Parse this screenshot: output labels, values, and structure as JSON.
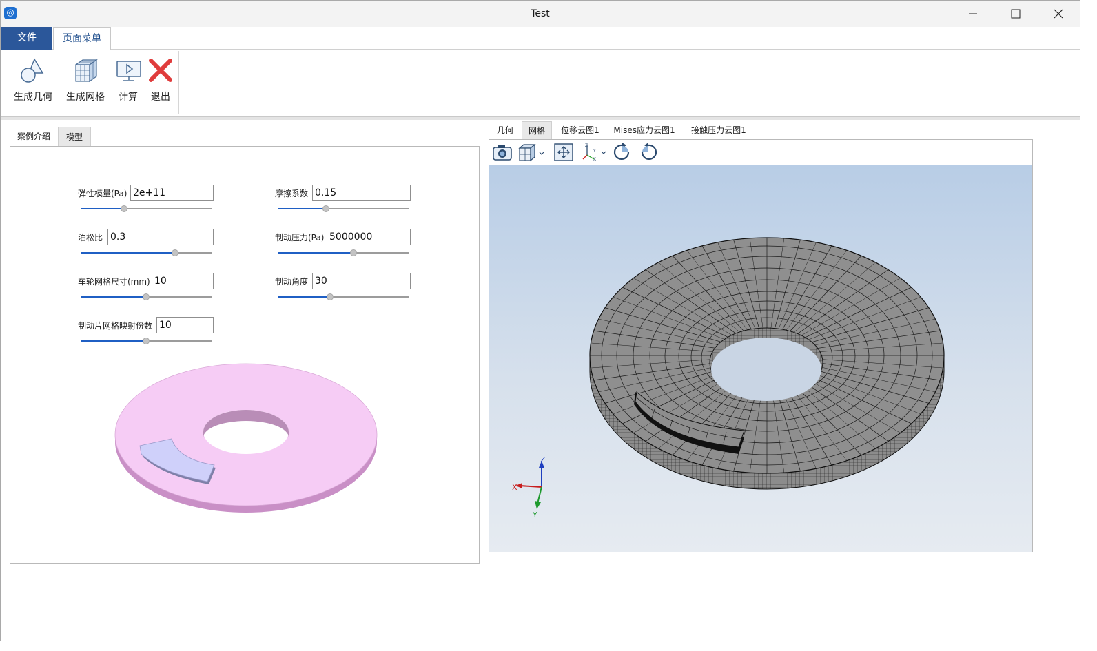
{
  "window": {
    "title": "Test"
  },
  "ribbon": {
    "tabs": [
      {
        "label": "文件"
      },
      {
        "label": "页面菜单"
      }
    ],
    "buttons": [
      {
        "label": "生成几何",
        "icon": "geometry-icon"
      },
      {
        "label": "生成网格",
        "icon": "mesh-cube-icon"
      },
      {
        "label": "计算",
        "icon": "compute-monitor-icon"
      },
      {
        "label": "退出",
        "icon": "exit-x-icon"
      }
    ]
  },
  "left_panel": {
    "tabs": [
      {
        "label": "案例介绍"
      },
      {
        "label": "模型"
      }
    ],
    "active_tab": "模型",
    "fields": {
      "elastic_modulus": {
        "label": "弹性模量(Pa)",
        "value": "2e+11",
        "slider": 0.33
      },
      "poisson": {
        "label": "泊松比",
        "value": "0.3",
        "slider": 0.72
      },
      "wheel_mesh": {
        "label": "车轮网格尺寸(mm)",
        "value": "10",
        "slider": 0.5
      },
      "pad_mesh": {
        "label": "制动片网格映射份数",
        "value": "10",
        "slider": 0.5
      },
      "friction": {
        "label": "摩擦系数",
        "value": "0.15",
        "slider": 0.37
      },
      "brake_pressure": {
        "label": "制动压力(Pa)",
        "value": "5000000",
        "slider": 0.58
      },
      "brake_angle": {
        "label": "制动角度",
        "value": "30",
        "slider": 0.4
      }
    }
  },
  "right_panel": {
    "tabs": [
      {
        "label": "几何"
      },
      {
        "label": "网格"
      },
      {
        "label": "位移云图1"
      },
      {
        "label": "Mises应力云图1"
      },
      {
        "label": "接触压力云图1"
      }
    ],
    "active_tab": "网格",
    "toolbar": [
      "camera-icon",
      "view-cube-icon",
      "fit-view-icon",
      "axes-orient-icon",
      "rotate-cw-icon",
      "rotate-ccw-icon"
    ],
    "axes": {
      "x": "X",
      "y": "Y",
      "z": "Z"
    }
  },
  "colors": {
    "accent": "#2b579a",
    "disc_pink": "#f6ccf5",
    "pad_lavender": "#cfd0fa",
    "mesh_gray": "#8f8f8f",
    "slider_blue": "#1f5fc4"
  }
}
